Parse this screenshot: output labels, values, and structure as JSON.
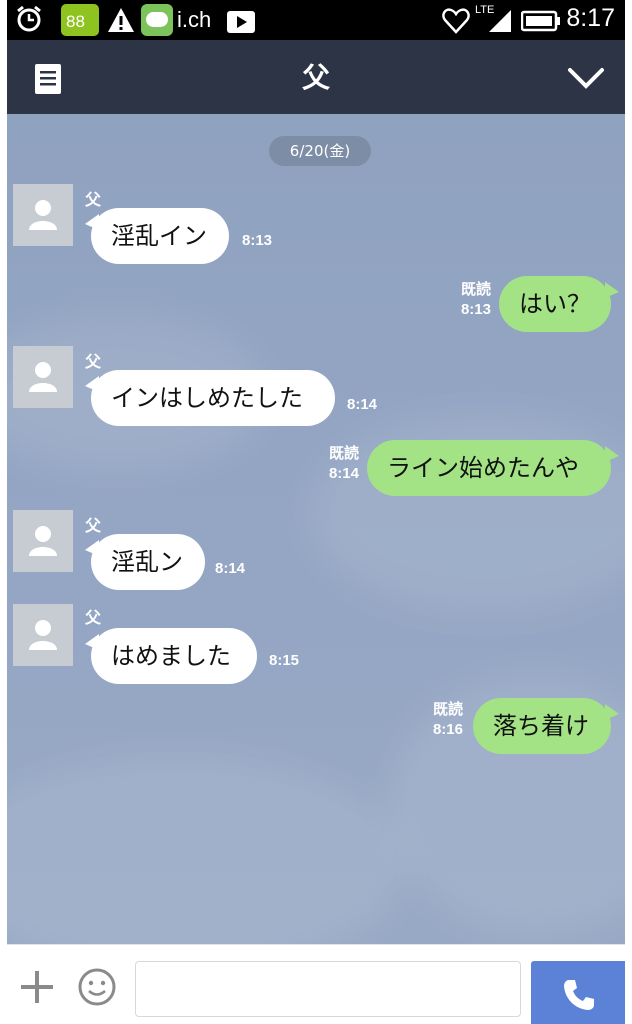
{
  "status_bar": {
    "notification_badge": "88",
    "app_label": "i.ch",
    "network": "LTE",
    "time": "8:17"
  },
  "header": {
    "title": "父"
  },
  "chat": {
    "date_label": "6/20(金)",
    "read_label": "既読",
    "messages": [
      {
        "sender": "父",
        "text": "淫乱イン",
        "time": "8:13",
        "direction": "in"
      },
      {
        "text": "はい？",
        "time": "8:13",
        "direction": "out",
        "read": "既読"
      },
      {
        "sender": "父",
        "text": "インはしめたした",
        "time": "8:14",
        "direction": "in"
      },
      {
        "text": "ライン始めたんや",
        "time": "8:14",
        "direction": "out",
        "read": "既読"
      },
      {
        "sender": "父",
        "text": "淫乱ン",
        "time": "8:14",
        "direction": "in"
      },
      {
        "sender": "父",
        "text": "はめました",
        "time": "8:15",
        "direction": "in"
      },
      {
        "text": "落ち着け",
        "time": "8:16",
        "direction": "out",
        "read": "既読"
      }
    ]
  },
  "input": {
    "placeholder": ""
  },
  "icons": {
    "menu": "menu-list-icon",
    "chevron": "chevron-down-icon",
    "plus": "plus-icon",
    "emoji": "smiley-icon",
    "call": "phone-icon",
    "avatar": "person-icon"
  },
  "colors": {
    "header_bg": "#2d3446",
    "chat_bg": "#93a5c3",
    "incoming_bubble": "#ffffff",
    "outgoing_bubble": "#a3e285",
    "call_button": "#5b82d6"
  }
}
